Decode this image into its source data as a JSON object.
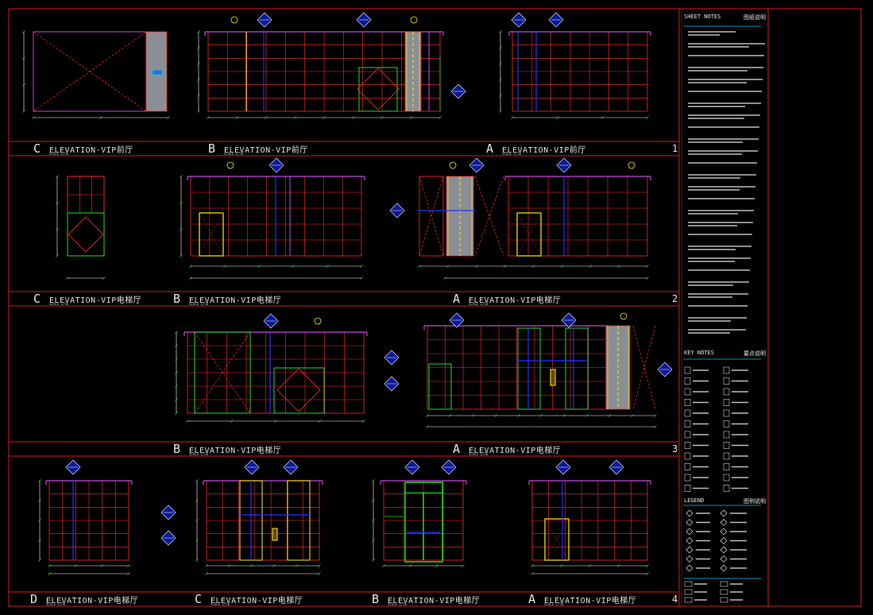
{
  "colors": {
    "bg": "#000000",
    "frame": "#d61b1b",
    "grid": "#ff2a2a",
    "wall": "#c04bd6",
    "blue": "#2233ff",
    "green": "#22dd22",
    "yellow": "#ffee00",
    "white": "#ffffff",
    "grey": "#8a8f96",
    "cyan": "#00c8ff",
    "text": "#d0d0d0"
  },
  "rows": [
    {
      "number": "1",
      "views": [
        {
          "letter": "C",
          "title": "ELEVATION-VIP前厅",
          "scale": "SCALE 1/50"
        },
        {
          "letter": "B",
          "title": "ELEVATION-VIP前厅",
          "scale": "SCALE 1/50"
        },
        {
          "letter": "A",
          "title": "ELEVATION-VIP前厅",
          "scale": "SCALE 1/50"
        }
      ]
    },
    {
      "number": "2",
      "views": [
        {
          "letter": "C",
          "title": "ELEVATION-VIP电梯厅",
          "scale": "SCALE 1/50"
        },
        {
          "letter": "B",
          "title": "ELEVATION-VIP电梯厅",
          "scale": "SCALE 1/50"
        },
        {
          "letter": "A",
          "title": "ELEVATION-VIP电梯厅",
          "scale": "SCALE 1/50"
        }
      ]
    },
    {
      "number": "3",
      "views": [
        {
          "letter": "B",
          "title": "ELEVATION-VIP电梯厅",
          "scale": "SCALE 1/50"
        },
        {
          "letter": "A",
          "title": "ELEVATION-VIP电梯厅",
          "scale": "SCALE 1/50"
        }
      ]
    },
    {
      "number": "4",
      "views": [
        {
          "letter": "D",
          "title": "ELEVATION-VIP电梯厅",
          "scale": "SCALE 1/50"
        },
        {
          "letter": "C",
          "title": "ELEVATION-VIP电梯厅",
          "scale": "SCALE 1/50"
        },
        {
          "letter": "B",
          "title": "ELEVATION-VIP电梯厅",
          "scale": "SCALE 1/50"
        },
        {
          "letter": "A",
          "title": "ELEVATION-VIP电梯厅",
          "scale": "SCALE 1/50"
        }
      ]
    }
  ],
  "side": {
    "sheet_notes_title": "SHEET NOTES",
    "sheet_notes_cn": "图纸说明",
    "key_notes_title": "KEY NOTES",
    "key_notes_cn": "要点说明",
    "legend_title": "LEGEND",
    "legend_cn": "图例说明"
  }
}
